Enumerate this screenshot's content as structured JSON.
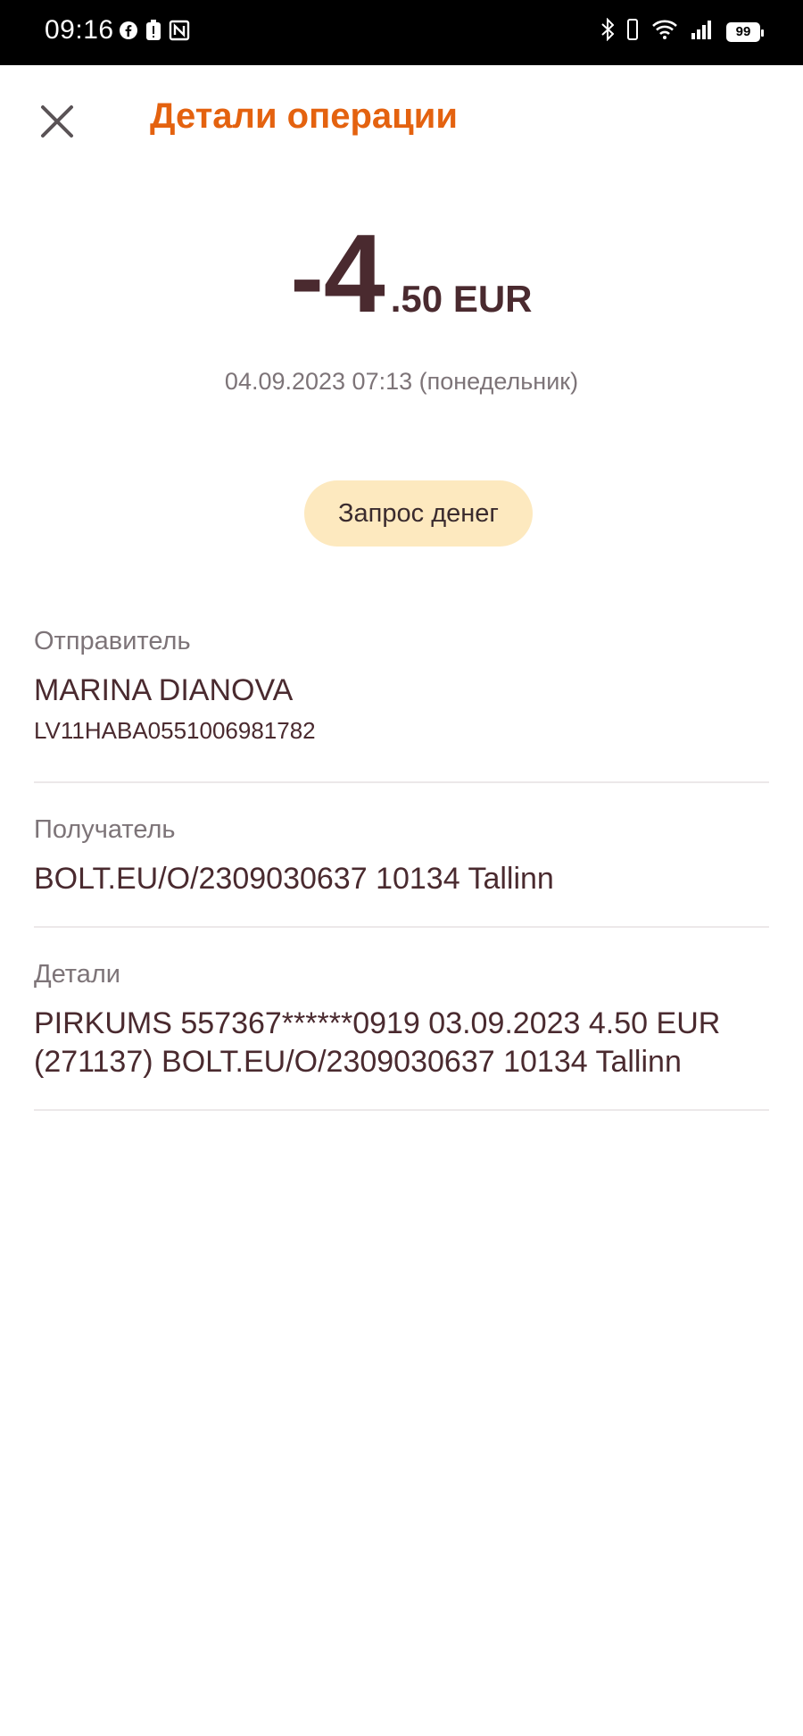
{
  "status_bar": {
    "time": "09:16",
    "battery": "99",
    "icons": [
      "facebook-icon",
      "alert-icon",
      "nfc-icon",
      "bluetooth-icon",
      "vibrate-icon",
      "wifi-icon",
      "signal-icon",
      "battery-icon"
    ]
  },
  "header": {
    "title": "Детали операции",
    "close_icon": "close-icon"
  },
  "amount": {
    "sign": "-",
    "integer": "4",
    "fraction_currency": ".50 EUR",
    "datetime": "04.09.2023 07:13 (понедельник)"
  },
  "request_button": {
    "label": "Запрос денег"
  },
  "sender": {
    "label": "Отправитель",
    "name": "MARINA DIANOVA",
    "account": "LV11HABA0551006981782"
  },
  "recipient": {
    "label": "Получатель",
    "value": "BOLT.EU/O/2309030637 10134 Tallinn"
  },
  "details": {
    "label": "Детали",
    "line1": "PIRKUMS 557367******0919 03.09.2023 4.50 EUR",
    "line2": "(271137) BOLT.EU/O/2309030637 10134 Tallinn"
  },
  "colors": {
    "accent": "#e4620f",
    "text_primary": "#4a2a2f",
    "text_secondary": "#7d7478",
    "pill_bg": "#fde9bf",
    "divider": "#ece8e9"
  }
}
